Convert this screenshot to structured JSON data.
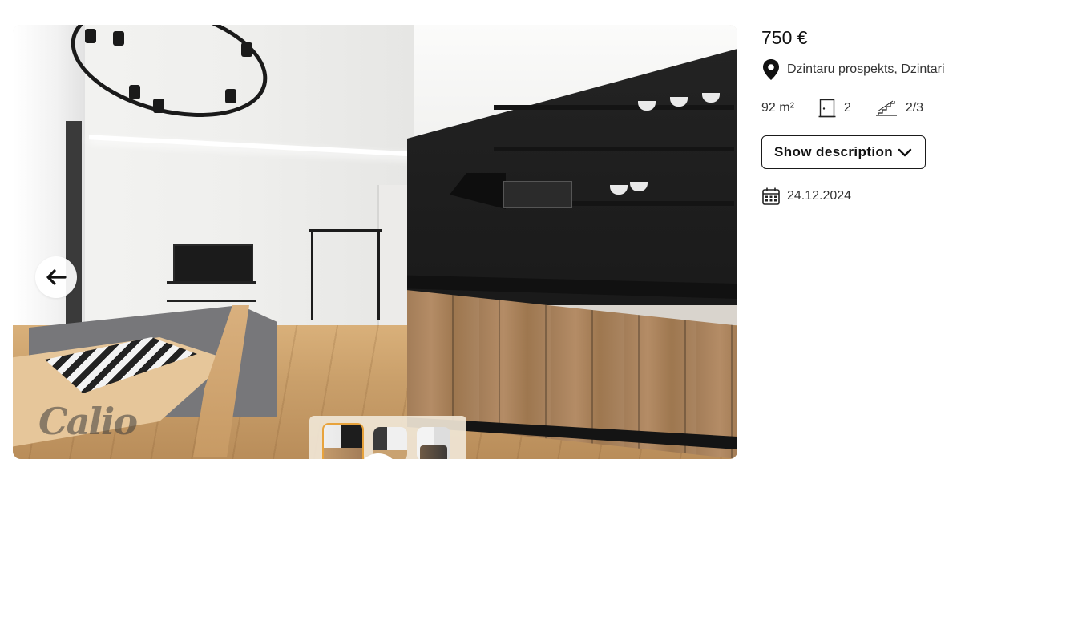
{
  "gallery": {
    "watermark": "Calio",
    "thumbnails": [
      {
        "name": "kitchen-living-room",
        "active": true
      },
      {
        "name": "living-room",
        "active": false
      },
      {
        "name": "dining-room",
        "active": false
      }
    ],
    "prev_icon": "arrow-left-icon",
    "next_icon": "arrow-right-icon"
  },
  "listing": {
    "price": "750 €",
    "address": "Dzintaru prospekts, Dzintari",
    "area": "92 m²",
    "rooms": "2",
    "floor": "2/3",
    "description_button": "Show description",
    "date": "24.12.2024"
  },
  "icons": {
    "address": "map-pin-icon",
    "rooms": "door-icon",
    "floor": "stairs-icon",
    "expand": "chevron-down-icon",
    "date": "calendar-icon"
  },
  "colors": {
    "active_thumb_border": "#e8a33c",
    "thumb_strip_bg": "#f0e6d6",
    "text": "#333333"
  }
}
